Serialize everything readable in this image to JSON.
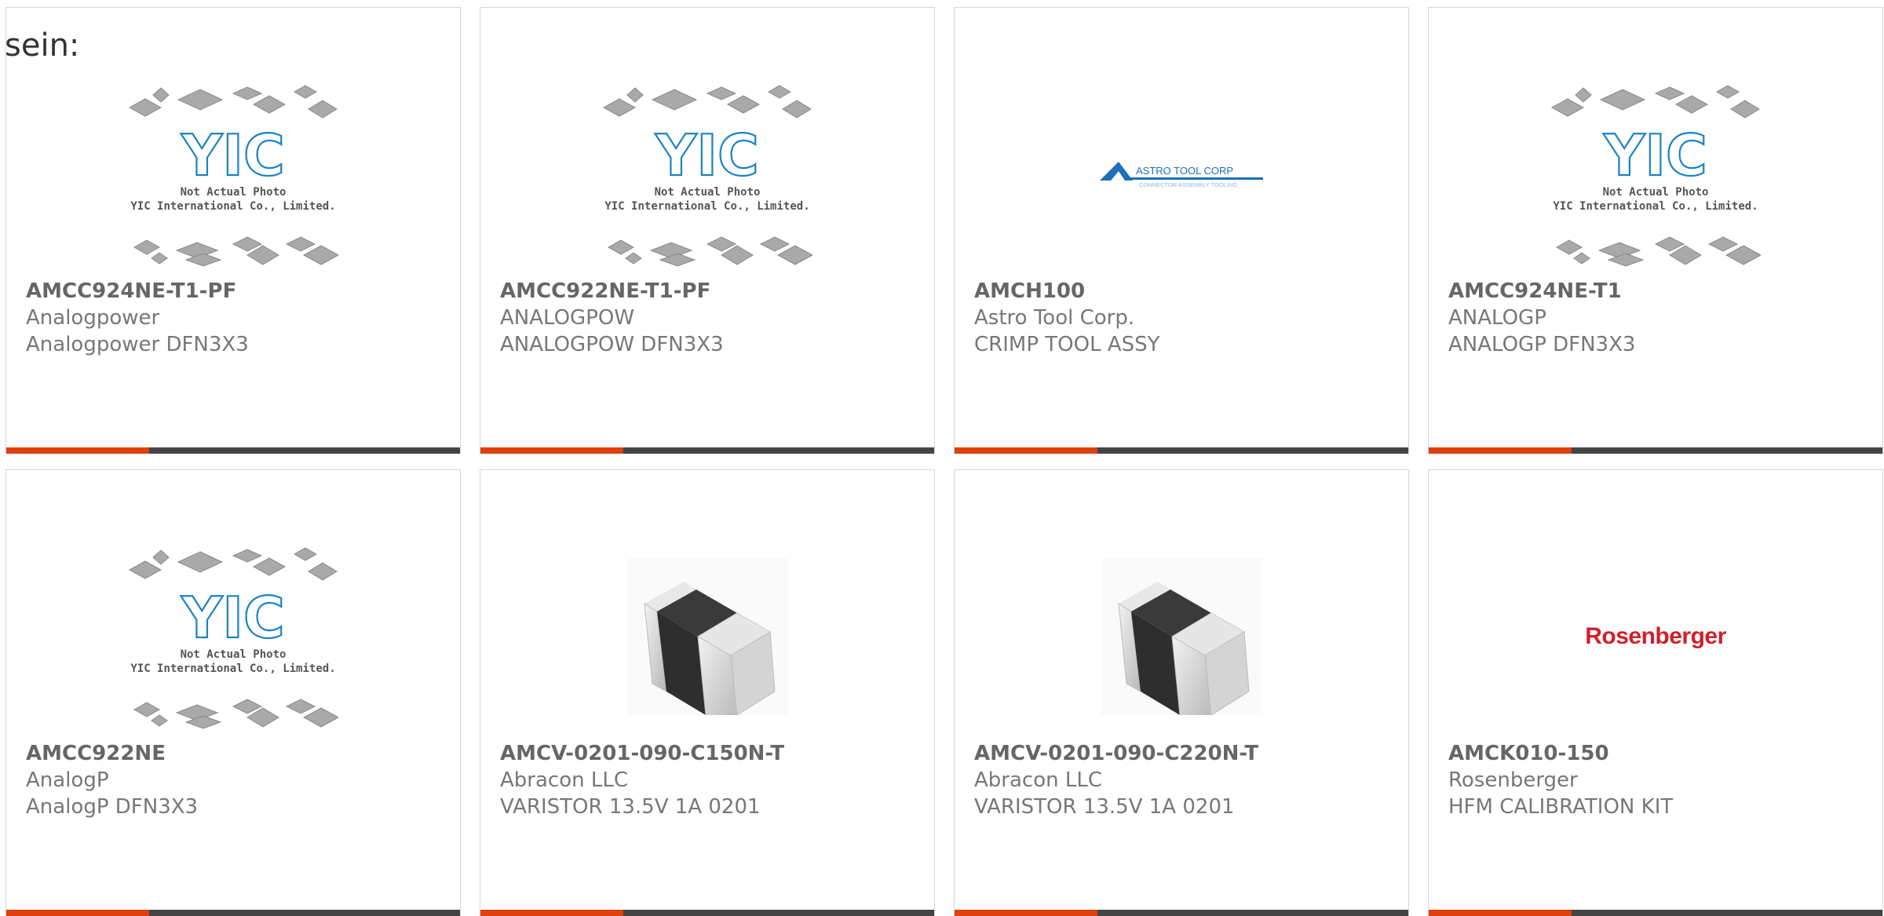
{
  "page": {
    "prefix_text": "sein:"
  },
  "colors": {
    "accent": "#e0400e",
    "bar_dark": "#444444",
    "yic_blue": "#1a82c4",
    "astro_blue": "#1d6fb8",
    "rosenberger_red": "#d0202a"
  },
  "placeholder": {
    "line1": "Not Actual Photo",
    "line2": "YIC International Co., Limited.",
    "logo": "YIC"
  },
  "astro_logo": {
    "name": "ASTRO TOOL CORP",
    "tagline": "CONNECTOR ASSEMBLY TOOLING"
  },
  "rosenberger_logo": {
    "name": "Rosenberger"
  },
  "products": [
    {
      "part_number": "AMCC924NE-T1-PF",
      "manufacturer": "Analogpower",
      "description": "Analogpower DFN3X3",
      "image": "placeholder-icon"
    },
    {
      "part_number": "AMCC922NE-T1-PF",
      "manufacturer": "ANALOGPOW",
      "description": "ANALOGPOW DFN3X3",
      "image": "placeholder-icon"
    },
    {
      "part_number": "AMCH100",
      "manufacturer": "Astro Tool Corp.",
      "description": "CRIMP TOOL ASSY",
      "image": "astro-tool-logo"
    },
    {
      "part_number": "AMCC924NE-T1",
      "manufacturer": "ANALOGP",
      "description": "ANALOGP DFN3X3",
      "image": "placeholder-icon"
    },
    {
      "part_number": "AMCC922NE",
      "manufacturer": "AnalogP",
      "description": "AnalogP DFN3X3",
      "image": "placeholder-icon"
    },
    {
      "part_number": "AMCV-0201-090-C150N-T",
      "manufacturer": "Abracon LLC",
      "description": "VARISTOR 13.5V 1A 0201",
      "image": "chip-component"
    },
    {
      "part_number": "AMCV-0201-090-C220N-T",
      "manufacturer": "Abracon LLC",
      "description": "VARISTOR 13.5V 1A 0201",
      "image": "chip-component"
    },
    {
      "part_number": "AMCK010-150",
      "manufacturer": "Rosenberger",
      "description": "HFM CALIBRATION KIT",
      "image": "rosenberger-logo"
    }
  ]
}
